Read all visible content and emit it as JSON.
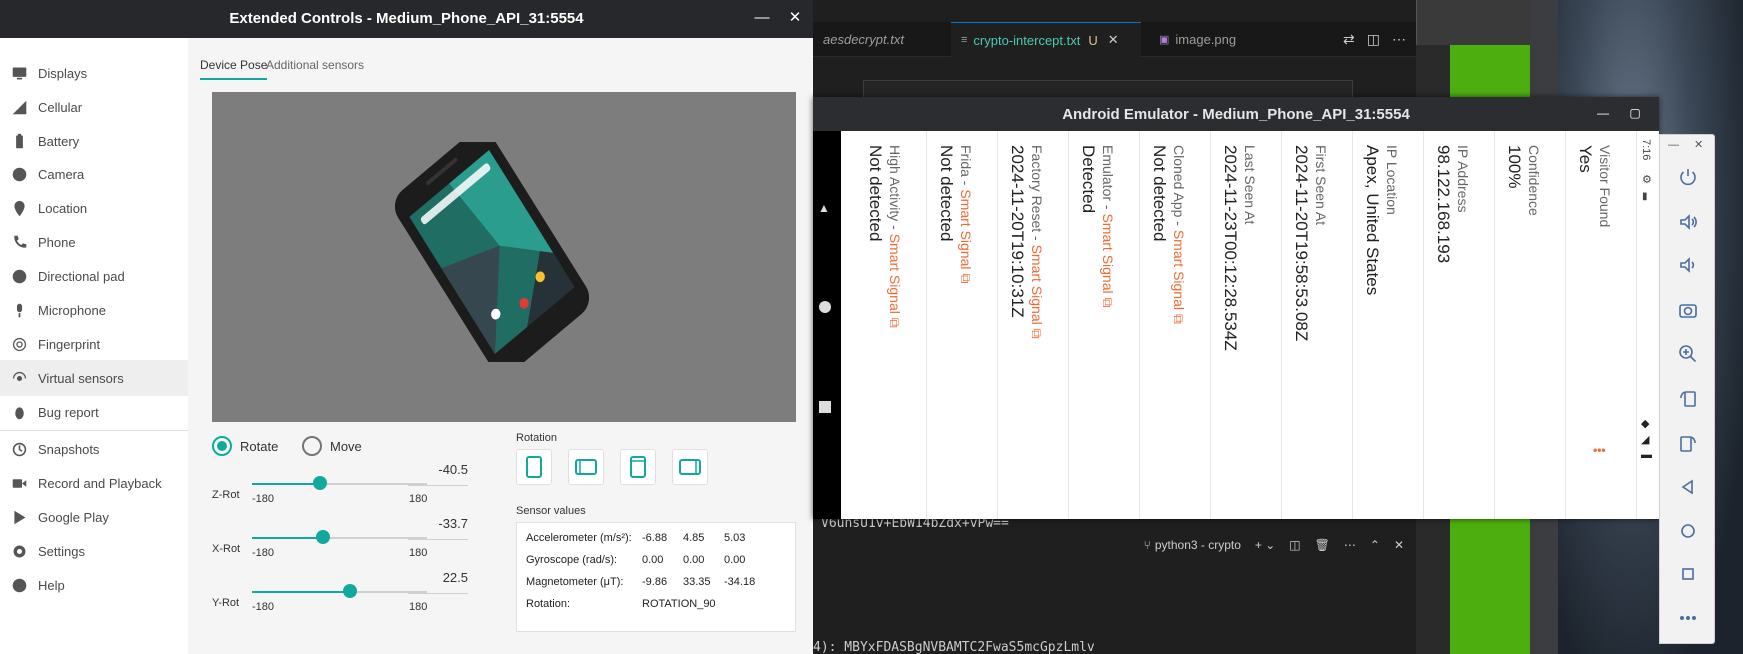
{
  "ext_window": {
    "title": "Extended Controls - Medium_Phone_API_31:5554",
    "sidebar": [
      {
        "label": "Displays",
        "icon": "display-icon"
      },
      {
        "label": "Cellular",
        "icon": "signal-icon"
      },
      {
        "label": "Battery",
        "icon": "battery-icon"
      },
      {
        "label": "Camera",
        "icon": "camera-icon"
      },
      {
        "label": "Location",
        "icon": "location-pin-icon"
      },
      {
        "label": "Phone",
        "icon": "phone-icon"
      },
      {
        "label": "Directional pad",
        "icon": "dpad-icon"
      },
      {
        "label": "Microphone",
        "icon": "microphone-icon"
      },
      {
        "label": "Fingerprint",
        "icon": "fingerprint-icon"
      },
      {
        "label": "Virtual sensors",
        "icon": "sensors-icon",
        "selected": true
      },
      {
        "label": "Bug report",
        "icon": "bug-icon"
      },
      {
        "label": "Snapshots",
        "icon": "history-icon"
      },
      {
        "label": "Record and Playback",
        "icon": "video-icon"
      },
      {
        "label": "Google Play",
        "icon": "play-icon"
      },
      {
        "label": "Settings",
        "icon": "gear-icon"
      },
      {
        "label": "Help",
        "icon": "help-icon"
      }
    ],
    "tabs": {
      "device_pose": "Device Pose",
      "additional_sensors": "Additional sensors"
    },
    "mode": {
      "rotate": "Rotate",
      "move": "Move",
      "selected": "rotate"
    },
    "sliders": [
      {
        "label": "Z-Rot",
        "min": "-180",
        "max": "180",
        "value": "-40.5",
        "num": -40.5
      },
      {
        "label": "X-Rot",
        "min": "-180",
        "max": "180",
        "value": "-33.7",
        "num": -33.7
      },
      {
        "label": "Y-Rot",
        "min": "-180",
        "max": "180",
        "value": "22.5",
        "num": 22.5
      }
    ],
    "rotation_label": "Rotation",
    "sensor_values_label": "Sensor values",
    "sensor_values": [
      {
        "name": "Accelerometer (m/s²):",
        "values": [
          "-6.88",
          "4.85",
          "5.03"
        ]
      },
      {
        "name": "Gyroscope (rad/s):",
        "values": [
          "0.00",
          "0.00",
          "0.00"
        ]
      },
      {
        "name": "Magnetometer (μT):",
        "values": [
          "-9.86",
          "33.35",
          "-34.18"
        ]
      },
      {
        "name": "Rotation:",
        "values": [
          "ROTATION_90",
          "",
          ""
        ]
      }
    ],
    "accent": "#13a89e"
  },
  "vscode": {
    "tabs": [
      {
        "label": "aesdecrypt.txt",
        "modified": ""
      },
      {
        "label": "crypto-intercept.txt",
        "modified": "U"
      },
      {
        "label": "image.png",
        "modified": ""
      }
    ],
    "code_line": "V6unsU1v+EbW14bZdx+vPw==",
    "terminal_name": "python3 - crypto",
    "terminal_line": "4): MBYxFDASBgNVBAMTC2FwaS5mcGpzLmlv"
  },
  "emulator": {
    "title": "Android Emulator - Medium_Phone_API_31:5554",
    "status_time": "7:16",
    "columns": [
      {
        "label": "Visitor Found",
        "value": "Yes",
        "signal": ""
      },
      {
        "label": "Confidence",
        "value": "100%",
        "signal": ""
      },
      {
        "label": "IP Address",
        "value": "98.122.168.193",
        "signal": ""
      },
      {
        "label": "IP Location",
        "value": "Apex, United States",
        "signal": ""
      },
      {
        "label": "First Seen At",
        "value": "2024-11-20T19:58:53.08Z",
        "signal": ""
      },
      {
        "label": "Last Seen At",
        "value": "2024-11-23T00:12:28.534Z",
        "signal": ""
      },
      {
        "label": "Cloned App - ",
        "value": "Not detected",
        "signal": "Smart Signal"
      },
      {
        "label": "Emulator - ",
        "value": "Detected",
        "signal": "Smart Signal"
      },
      {
        "label": "Factory Reset - ",
        "value": "2024-11-20T19:10:31Z",
        "signal": "Smart Signal"
      },
      {
        "label": "Frida - ",
        "value": "Not detected",
        "signal": "Smart Signal"
      },
      {
        "label": "High Activity - ",
        "value": "Not detected",
        "signal": "Smart Signal"
      }
    ],
    "more_label": "•••",
    "signal_color": "#f06a35"
  },
  "toolbar": [
    "power-icon",
    "volume-up-icon",
    "volume-down-icon",
    "camera-icon",
    "zoom-icon",
    "rotate-left-icon",
    "rotate-right-icon",
    "back-icon",
    "home-icon",
    "overview-icon",
    "more-icon"
  ]
}
